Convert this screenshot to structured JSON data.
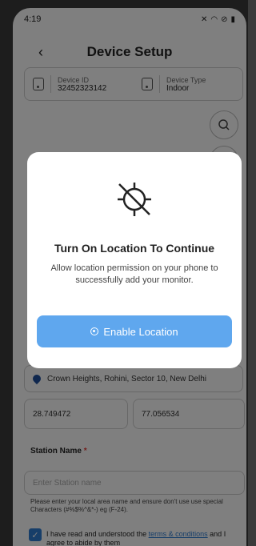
{
  "status_bar": {
    "time": "4:19",
    "icons": [
      "mute-icon",
      "wifi-icon",
      "dnd-icon",
      "battery-icon"
    ]
  },
  "header": {
    "title": "Device Setup",
    "back_icon": "chevron-left-icon"
  },
  "device_info": {
    "device_id_label": "Device ID",
    "device_id_value": "32452323142",
    "device_type_label": "Device Type",
    "device_type_value": "Indoor"
  },
  "location": {
    "address": "Crown Heights, Rohini, Sector 10, New Delhi",
    "latitude": "28.749472",
    "longitude": "77.056534"
  },
  "station": {
    "label": "Station Name",
    "required_mark": "*",
    "placeholder": "Enter Station name",
    "hint": "Please enter your local area name and ensure don't use use special Characters (#%$%^&*-) eg (F-24)."
  },
  "terms": {
    "text": "I have read and understood the",
    "link": "terms & conditions",
    "text2": "and I agree to abide by them",
    "checked": true
  },
  "modal": {
    "icon": "location-off-icon",
    "title": "Turn On Location To Continue",
    "description": "Allow location permission on your phone to successfully add your monitor.",
    "button_label": "Enable Location"
  },
  "colors": {
    "accent": "#5fa7ee",
    "checkbox": "#2f7dd3",
    "pin": "#1f4e9c"
  }
}
